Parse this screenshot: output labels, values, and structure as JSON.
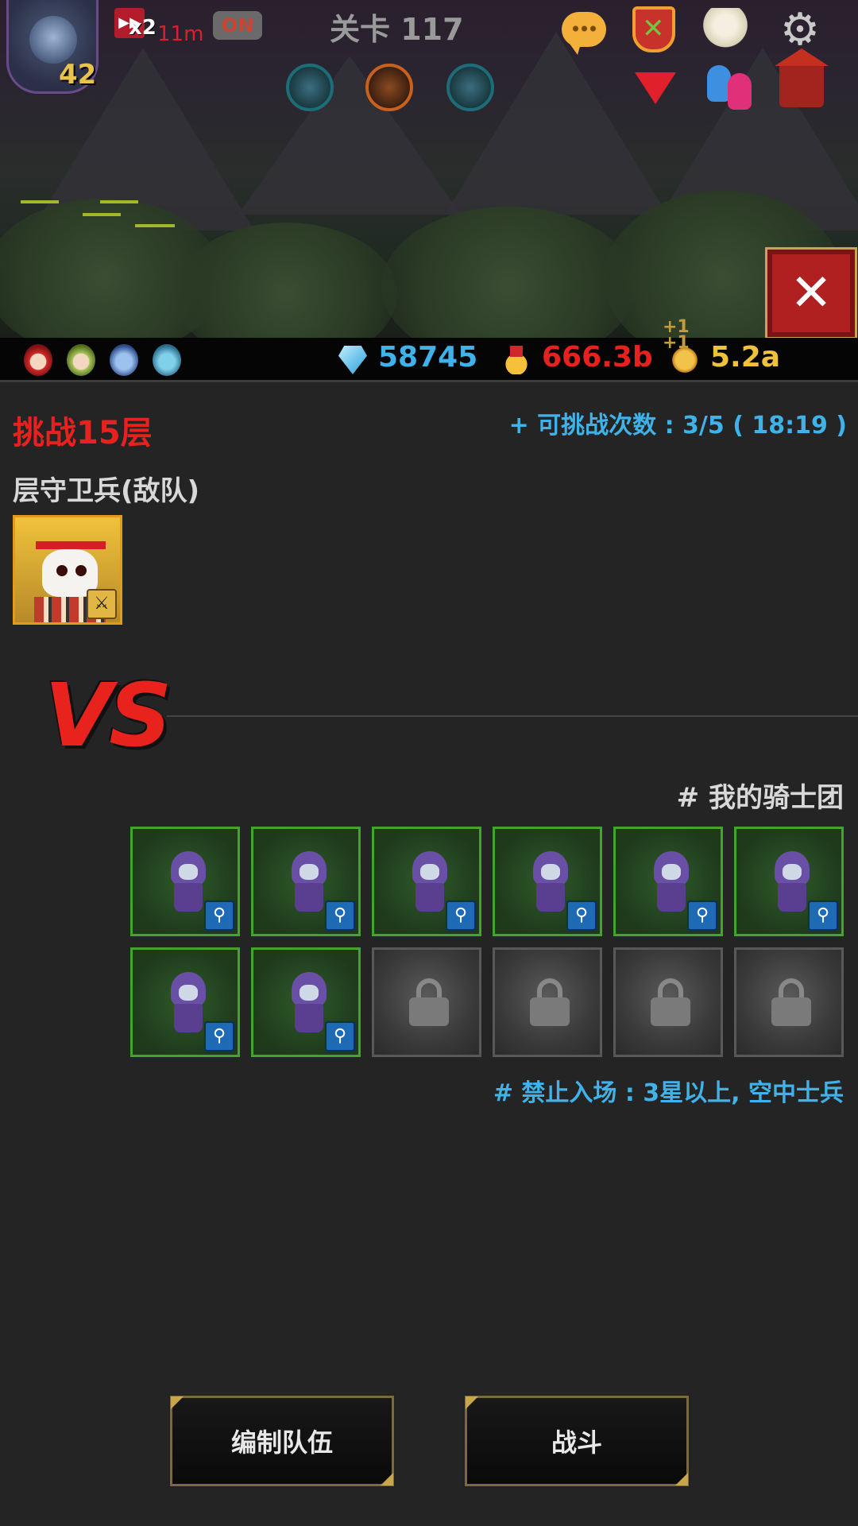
{
  "hud": {
    "player_level": "42",
    "speed_multiplier": "x2",
    "speed_time": "11m",
    "auto_toggle": "ON",
    "stage_label": "关卡 117"
  },
  "resources": {
    "diamonds": "58745",
    "medals": "666.3b",
    "coins": "5.2a",
    "bonus_top": "+1",
    "bonus_bottom": "+1",
    "colors": {
      "diamonds": "#3fb2ea",
      "medals": "#e8211f",
      "coins": "#f0c23a"
    }
  },
  "challenge": {
    "title": "挑战15层",
    "attempts": "+ 可挑战次数 : 3/5 ( 18:19 )",
    "guard_label": "层守卫兵(敌队)",
    "vs": "VS",
    "team_title": "# 我的骑士团",
    "restriction": "# 禁止入场 : 3星以上, 空中士兵"
  },
  "team": {
    "slots": [
      {
        "state": "filled"
      },
      {
        "state": "filled"
      },
      {
        "state": "filled"
      },
      {
        "state": "filled"
      },
      {
        "state": "filled"
      },
      {
        "state": "filled"
      },
      {
        "state": "filled"
      },
      {
        "state": "filled"
      },
      {
        "state": "locked"
      },
      {
        "state": "locked"
      },
      {
        "state": "locked"
      },
      {
        "state": "locked"
      }
    ]
  },
  "buttons": {
    "edit_team": "编制队伍",
    "fight": "战斗"
  },
  "icons": {
    "chat": "chat-icon",
    "battle": "battle-icon",
    "angel": "angel-icon",
    "settings": "gear-icon",
    "dropdown": "down-triangle-icon",
    "friends": "friends-icon",
    "home": "house-icon",
    "close": "close-icon",
    "lock": "lock-icon",
    "magic": "magnifier-icon",
    "weapon": "sword-icon"
  },
  "colors": {
    "accent_red": "#e8211f",
    "accent_blue": "#3fb2ea",
    "slot_filled_border": "#41a52a",
    "slot_locked_border": "#585858",
    "enemy_border": "#e39a1a"
  }
}
